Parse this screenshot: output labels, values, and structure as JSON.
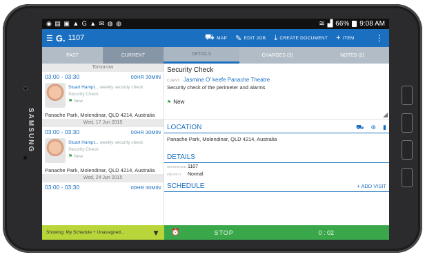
{
  "device": {
    "brand": "SAMSUNG"
  },
  "statusbar": {
    "left_icons": "◉ ▤ ▣ ▲ G ▲ ✉ ◍ ◍",
    "right_text": "66%",
    "time": "9:08 AM"
  },
  "appbar": {
    "title": "1107",
    "actions": [
      {
        "label": "MAP",
        "icon": "map-icon"
      },
      {
        "label": "EDIT JOB",
        "icon": "pencil-icon"
      },
      {
        "label": "CREATE DOCUMENT",
        "icon": "download-icon"
      },
      {
        "label": "ITEM",
        "icon": "plus-icon"
      }
    ]
  },
  "tabs": {
    "past": "PAST",
    "current": "CURRENT",
    "details": "DETAILS",
    "charges": "CHARGES (3)",
    "notes": "NOTES (2)"
  },
  "schedule": {
    "groups": [
      {
        "date": "Tomorrow",
        "time": "03:00 - 03:30",
        "duration": "00HR 30MIN",
        "who": "Stuart Hampt...",
        "type": "weekly security check",
        "title": "Security Check",
        "status": "New",
        "address": "Panache Park, Molendinar, QLD 4214, Australia"
      },
      {
        "date": "Wed, 17 Jun 2015",
        "time": "03:00 - 03:30",
        "duration": "00HR 30MIN",
        "who": "Stuart Hampt...",
        "type": "weekly security check",
        "title": "Security Check",
        "status": "New",
        "address": "Panache Park, Molendinar, QLD 4214, Australia"
      },
      {
        "date": "Wed, 24 Jun 2015",
        "time": "03:00 - 03:30",
        "duration": "00HR 30MIN"
      }
    ],
    "filter": "Showing: My Schedule + Unassigned..."
  },
  "detail": {
    "title": "Security Check",
    "client_label": "CLIENT",
    "client": "Jasmine O' keefe Panache Theatre",
    "description": "Security check of the perimeter and alarms",
    "status": "New",
    "location_heading": "LOCATION",
    "location_address": "Panache Park, Molendinar, QLD 4214, Australia",
    "details_heading": "DETAILS",
    "reference_label": "REFERENCE",
    "reference": "1107",
    "priority_label": "PRIORITY",
    "priority": "Normal",
    "schedule_heading": "SCHEDULE",
    "add_visit": "+ ADD VISIT"
  },
  "timer": {
    "stop_label": "STOP",
    "elapsed": "0 : 02"
  },
  "colors": {
    "primary": "#1a6fc0",
    "timer": "#3aa84a",
    "filter": "#b8d53a"
  }
}
